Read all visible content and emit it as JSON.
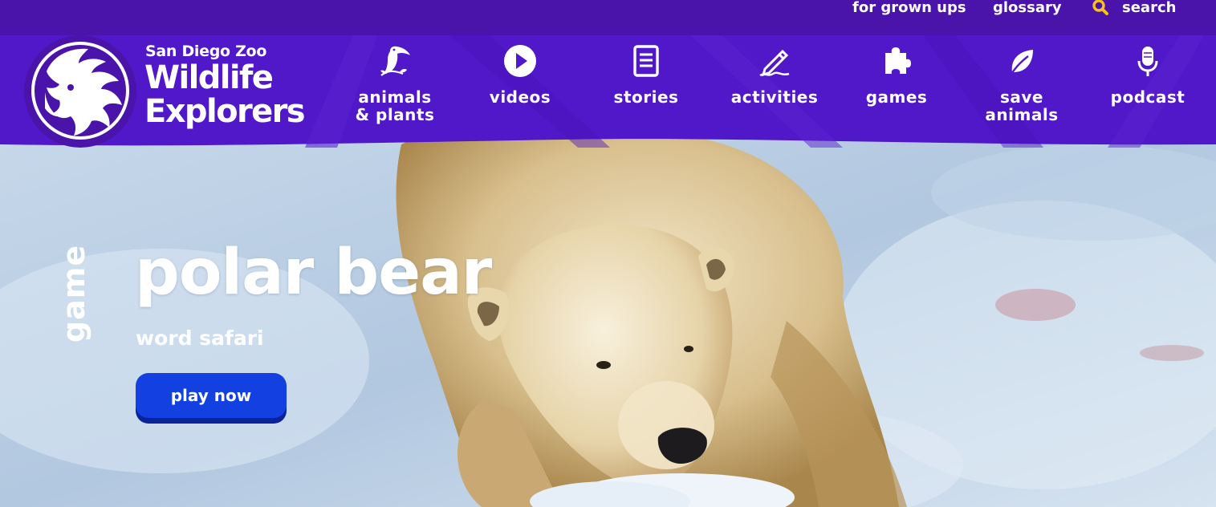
{
  "utility_nav": {
    "grown_ups": "for grown ups",
    "glossary": "glossary",
    "search": "search"
  },
  "logo": {
    "line1": "San Diego Zoo",
    "line2": "Wildlife",
    "line3": "Explorers"
  },
  "nav": {
    "items": [
      {
        "label_line1": "animals",
        "label_line2": "& plants",
        "icon": "toucan-icon"
      },
      {
        "label_line1": "videos",
        "label_line2": "",
        "icon": "play-icon"
      },
      {
        "label_line1": "stories",
        "label_line2": "",
        "icon": "document-icon"
      },
      {
        "label_line1": "activities",
        "label_line2": "",
        "icon": "pencil-icon"
      },
      {
        "label_line1": "games",
        "label_line2": "",
        "icon": "puzzle-icon"
      },
      {
        "label_line1": "save",
        "label_line2": "animals",
        "icon": "leaf-icon"
      },
      {
        "label_line1": "podcast",
        "label_line2": "",
        "icon": "microphone-icon"
      }
    ]
  },
  "hero": {
    "category": "game",
    "title": "polar bear",
    "subtitle": "word safari",
    "cta": "play now"
  },
  "colors": {
    "utility_bar": "#4a13aa",
    "nav_bg": "#5118c9",
    "cta": "#1340e0",
    "search_icon": "#f7c21a"
  }
}
